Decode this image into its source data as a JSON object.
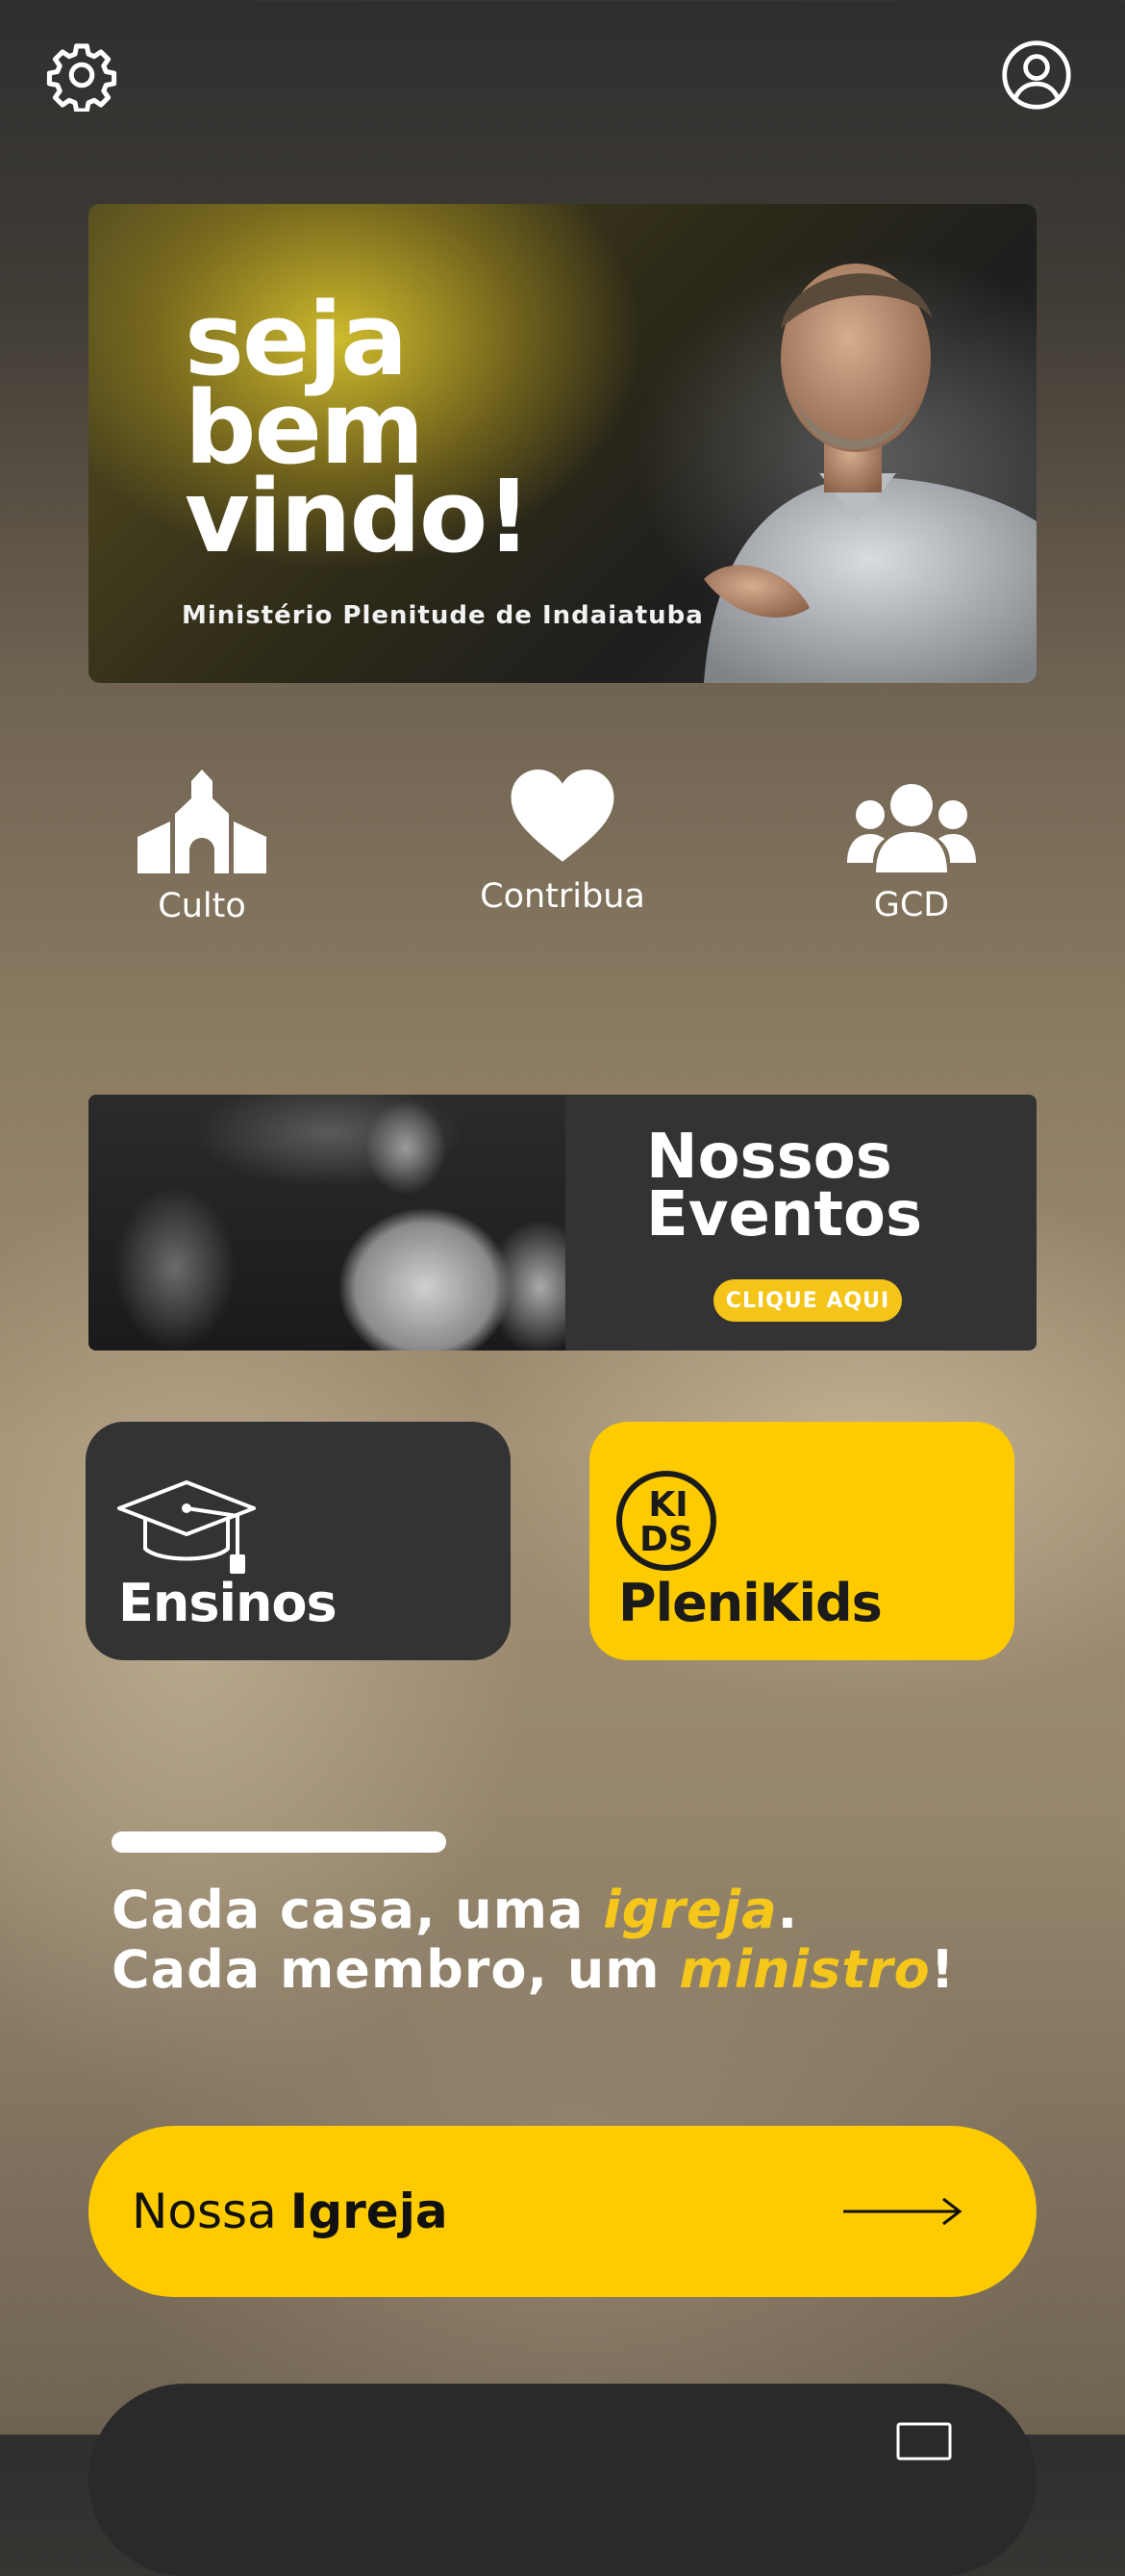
{
  "header": {
    "settings_icon": "gear-icon",
    "profile_icon": "user-circle-icon"
  },
  "hero": {
    "title_line1": "seja",
    "title_line2": "bem",
    "title_line3": "vindo!",
    "subtitle": "Ministério Plenitude de Indaiatuba"
  },
  "quick_actions": [
    {
      "label": "Culto",
      "icon": "church-icon"
    },
    {
      "label": "Contribua",
      "icon": "heart-icon"
    },
    {
      "label": "GCD",
      "icon": "group-icon"
    }
  ],
  "events_banner": {
    "title_line1": "Nossos",
    "title_line2": "Eventos",
    "cta": "CLIQUE AQUI"
  },
  "cards": {
    "ensinos": {
      "label": "Ensinos",
      "icon": "graduation-cap-icon",
      "color": "#333333"
    },
    "plenikids": {
      "label": "PleniKids",
      "logo_text": "KIDS",
      "color": "#fdcb00"
    }
  },
  "motto": {
    "line1_a": "Cada casa, uma ",
    "line1_highlight": "igreja",
    "line1_end": ".",
    "line2_a": "Cada membro, um ",
    "line2_highlight": "ministro",
    "line2_end": "!"
  },
  "cta_button": {
    "label_regular": "Nossa",
    "label_bold": "Igreja",
    "icon": "arrow-right-icon",
    "color": "#fdcb00"
  },
  "colors": {
    "accent": "#fdcb00",
    "dark_card": "#333333"
  }
}
